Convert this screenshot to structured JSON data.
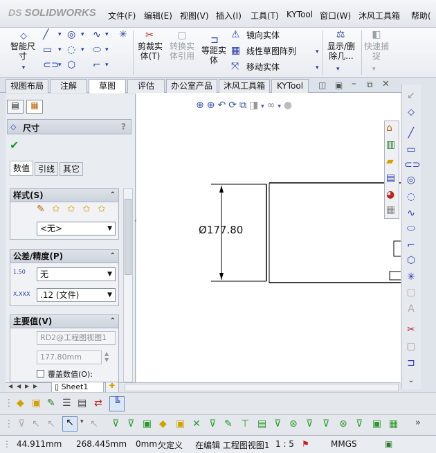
{
  "app": {
    "logo_text": "SOLIDWORKS",
    "logo_mark": "DS"
  },
  "menu": [
    "文件(F)",
    "编辑(E)",
    "视图(V)",
    "插入(I)",
    "工具(T)",
    "KYTool",
    "窗口(W)",
    "沐风工具箱",
    "帮助("
  ],
  "ribbon": {
    "smart_dim": "智能尺寸",
    "trim": "剪裁实体(T)",
    "convert": "转换实体引用",
    "offset": "等距实体",
    "mirror": "镜向实体",
    "linear_pattern": "线性草图阵列",
    "move": "移动实体",
    "show_delete": "显示/删除几...",
    "quick_snap": "快速捕捉"
  },
  "tabs": [
    "视图布局",
    "注解",
    "草图",
    "评估",
    "办公室产品",
    "沐风工具箱",
    "KYTool"
  ],
  "active_tab": "草图",
  "panel": {
    "title": "尺寸",
    "help": "?",
    "subtabs": [
      "数值",
      "引线",
      "其它"
    ],
    "style_label": "样式(S)",
    "style_value": "<无>",
    "tolerance_label": "公差/精度(P)",
    "tol_icon_a": "1.50",
    "tol_icon_b": "X.XXX",
    "tol_value": "无",
    "precision_value": ".12 (文件)",
    "primary_label": "主要值(V)",
    "primary_name": "RD2@工程图视图1",
    "primary_dim": "177.80mm",
    "override_label": "覆盖数值(O):"
  },
  "drawing": {
    "dimension": "Ø177.80"
  },
  "sheet": {
    "name": "Sheet1"
  },
  "status": {
    "x": "44.911mm",
    "y": "268.445mm",
    "z": "0mm",
    "state": "欠定义",
    "editing": "在编辑 工程图视图1",
    "scale": "1 : 5",
    "units": "MMGS"
  },
  "colors": {
    "accent": "#223bb0",
    "panel": "#e9ecf0",
    "check": "#1a9a2a"
  }
}
